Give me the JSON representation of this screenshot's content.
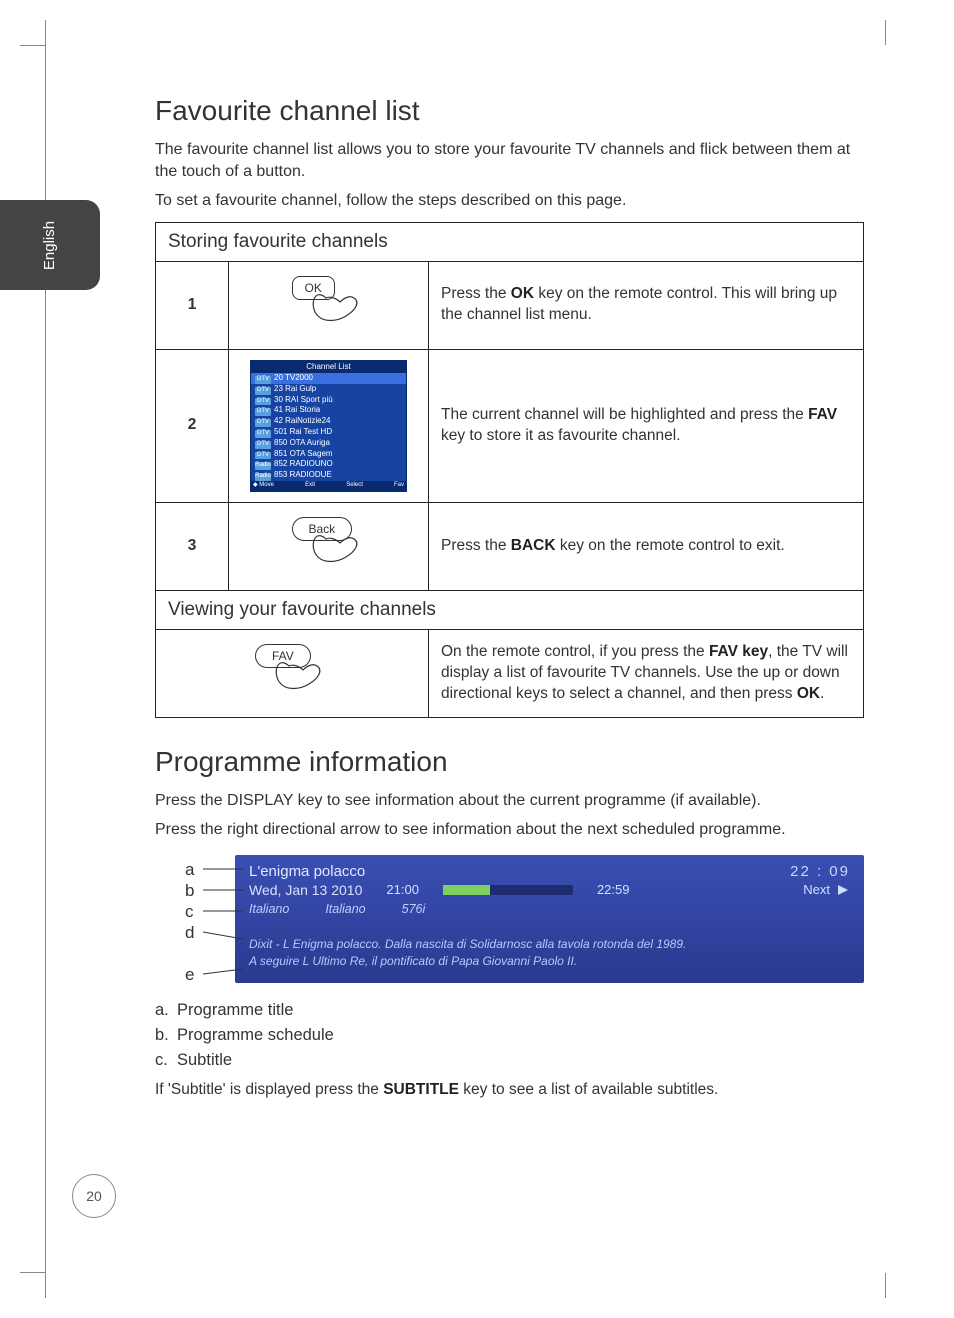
{
  "language_tab": "English",
  "page_number": "20",
  "section1": {
    "heading": "Favourite channel list",
    "intro": "The favourite channel list allows you to store your favourite TV channels and flick between them at the touch of a button.",
    "intro2": "To set a favourite channel, follow the steps described on this page.",
    "storing_header": "Storing favourite channels",
    "steps": [
      {
        "num": "1",
        "key_label": "OK",
        "text_prefix": "Press the ",
        "text_bold": "OK",
        "text_suffix": " key on the remote control. This will bring up the channel list menu."
      },
      {
        "num": "2",
        "osd_title": "Channel List",
        "osd_channels": [
          "20 TV2000",
          "23 Rai Gulp",
          "30 RAI Sport più",
          "41 Rai Storia",
          "42 RaiNotizie24",
          "501 Rai Test HD",
          "850 OTA Auriga",
          "851 OTA Sagem",
          "852 RADIOUNO",
          "853 RADIODUE"
        ],
        "osd_foot": [
          "Move",
          "Exit",
          "Select",
          "Fav"
        ],
        "text_prefix": "The current channel will be highlighted and press the ",
        "text_bold": "FAV",
        "text_suffix": " key to store it as favourite channel."
      },
      {
        "num": "3",
        "key_label": "Back",
        "text_prefix": "Press the ",
        "text_bold": "BACK",
        "text_suffix": " key on the remote control to exit."
      }
    ],
    "viewing_header": "Viewing your favourite channels",
    "viewing": {
      "key_label": "FAV",
      "text_prefix": "On the remote control, if you press the ",
      "text_bold1": "FAV key",
      "text_mid": ", the TV will display a list of favourite TV channels. Use the up or down directional keys to select a channel, and then press ",
      "text_bold2": "OK",
      "text_suffix": "."
    }
  },
  "section2": {
    "heading": "Programme information",
    "p1": "Press the DISPLAY key to see information about the current programme (if available).",
    "p2": "Press the right directional arrow to see information about the next scheduled programme.",
    "banner": {
      "title": "L'enigma polacco",
      "clock": "22 : 09",
      "date": "Wed, Jan 13 2010",
      "start": "21:00",
      "end": "22:59",
      "next": "Next",
      "audio1": "Italiano",
      "audio2": "Italiano",
      "res": "576i",
      "desc1": "Dixit - L Enigma polacco. Dalla nascita di Solidarnosc alla tavola rotonda del 1989.",
      "desc2": "A seguire L Ultimo Re, il pontificato di Papa Giovanni Paolo II."
    },
    "labels": {
      "a": "a",
      "b": "b",
      "c": "c",
      "d": "d",
      "e": "e"
    },
    "legend": {
      "a": "Programme title",
      "b": "Programme schedule",
      "c": "Subtitle"
    },
    "subtitle_note_prefix": "If 'Subtitle' is displayed press the ",
    "subtitle_note_bold": "SUBTITLE",
    "subtitle_note_suffix": " key to see a list of available subtitles."
  }
}
